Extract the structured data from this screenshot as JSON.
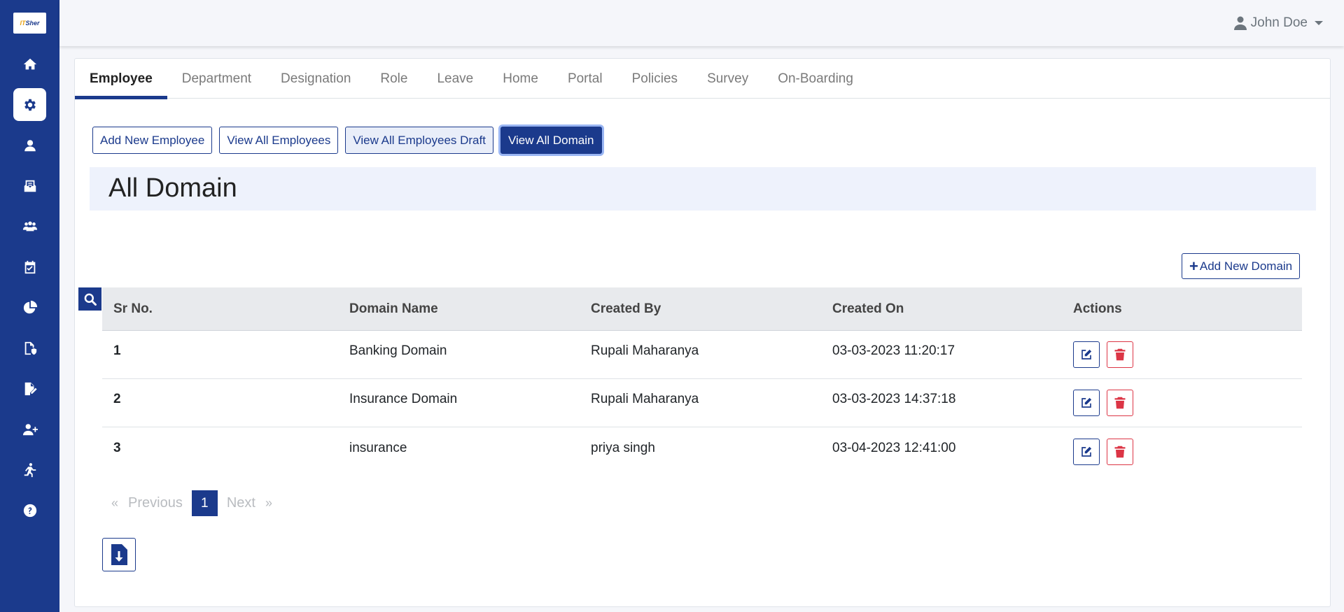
{
  "app": {
    "logo_text_a": "IT",
    "logo_text_b": "Sher"
  },
  "sidebar": {
    "items": [
      {
        "name": "home-icon"
      },
      {
        "name": "gear-icon",
        "active": true
      },
      {
        "name": "user-icon"
      },
      {
        "name": "inbox-icon"
      },
      {
        "name": "users-icon"
      },
      {
        "name": "calendar-check-icon"
      },
      {
        "name": "pie-chart-icon"
      },
      {
        "name": "file-shield-icon"
      },
      {
        "name": "file-signature-icon"
      },
      {
        "name": "user-plus-icon"
      },
      {
        "name": "person-running-icon"
      },
      {
        "name": "help-icon"
      }
    ]
  },
  "header": {
    "user_name": "John Doe"
  },
  "tabs": [
    "Employee",
    "Department",
    "Designation",
    "Role",
    "Leave",
    "Home",
    "Portal",
    "Policies",
    "Survey",
    "On-Boarding"
  ],
  "toolbar": {
    "add_new_employee": "Add New Employee",
    "view_all_employees": "View All Employees",
    "view_all_employees_draft": "View All Employees Draft",
    "view_all_domain": "View All Domain"
  },
  "page": {
    "title": "All Domain",
    "add_domain_plus": "+",
    "add_domain_label": "Add New Domain"
  },
  "table": {
    "headers": [
      "Sr No.",
      "Domain Name",
      "Created By",
      "Created On",
      "Actions"
    ],
    "rows": [
      {
        "sr": "1",
        "domain": "Banking Domain",
        "created_by": "Rupali Maharanya",
        "created_on": "03-03-2023 11:20:17"
      },
      {
        "sr": "2",
        "domain": "Insurance Domain",
        "created_by": "Rupali Maharanya",
        "created_on": "03-03-2023 14:37:18"
      },
      {
        "sr": "3",
        "domain": "insurance",
        "created_by": "priya singh",
        "created_on": "03-04-2023 12:41:00"
      }
    ]
  },
  "pagination": {
    "prev_symbol": "«",
    "prev_label": "Previous",
    "current_page": "1",
    "next_label": "Next",
    "next_symbol": "»"
  },
  "colors": {
    "primary": "#1b3a8c",
    "danger": "#dc3545",
    "header_bg": "#eef2fc"
  }
}
